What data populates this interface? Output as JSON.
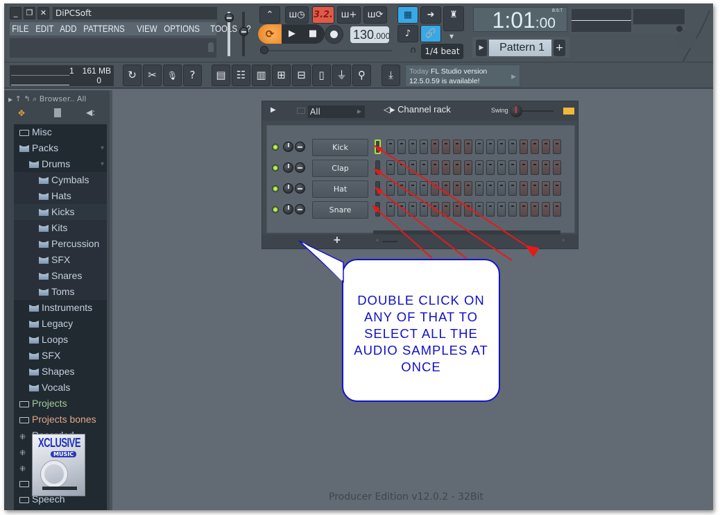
{
  "window": {
    "title": "DiPCSoft",
    "controls": {
      "minimize": "_",
      "restore": "❐",
      "close": "✕"
    }
  },
  "menu": [
    "FILE",
    "EDIT",
    "ADD",
    "PATTERNS",
    "VIEW",
    "OPTIONS",
    "TOOLS",
    "?"
  ],
  "transport": {
    "mode_display": "3.2.",
    "tempo_int": "130",
    "tempo_frac": ".000",
    "snap": "1/4 beat",
    "time_main": "1:01",
    "time_sub": ":00",
    "time_format": "B:S:T",
    "pattern": "Pattern 1",
    "pattern_add": "+",
    "loop_icon": "⟳",
    "play_icon": "▶",
    "stop_icon": "■"
  },
  "resources": {
    "cpu_value": "1",
    "memory": "161 MB",
    "polyphony": "0"
  },
  "toolbar": {
    "tools": [
      {
        "icon": "undo-icon",
        "glyph": "↻"
      },
      {
        "icon": "cut-icon",
        "glyph": "✂"
      },
      {
        "icon": "microphone-icon",
        "glyph": "🎙"
      },
      {
        "icon": "help-icon",
        "glyph": "?"
      }
    ],
    "windows": [
      {
        "icon": "playlist-icon",
        "glyph": "▤"
      },
      {
        "icon": "channel-rack-icon",
        "glyph": "☷"
      },
      {
        "icon": "piano-roll-icon",
        "glyph": "▥"
      },
      {
        "icon": "browser-icon",
        "glyph": "⊞"
      },
      {
        "icon": "mixer-icon",
        "glyph": "⊟"
      },
      {
        "icon": "project-info-icon",
        "glyph": "▯"
      },
      {
        "icon": "plugin-icon",
        "glyph": "⏚"
      },
      {
        "icon": "tempo-tapper-icon",
        "glyph": "⚲"
      }
    ],
    "download_glyph": "⤓"
  },
  "news": {
    "when": "Today",
    "line1": "FL Studio version",
    "line2": "12.5.0.59 is available!"
  },
  "browser": {
    "header": "Browser.. All",
    "items": [
      {
        "label": "Misc",
        "icon": "folder",
        "level": 0,
        "style": ""
      },
      {
        "label": "Packs",
        "icon": "pack",
        "level": 0,
        "style": ""
      },
      {
        "label": "Drums",
        "icon": "pack",
        "level": 1,
        "style": ""
      },
      {
        "label": "Cymbals",
        "icon": "pack",
        "level": 2,
        "style": ""
      },
      {
        "label": "Hats",
        "icon": "pack",
        "level": 2,
        "style": ""
      },
      {
        "label": "Kicks",
        "icon": "pack",
        "level": 2,
        "style": "selected"
      },
      {
        "label": "Kits",
        "icon": "pack",
        "level": 2,
        "style": ""
      },
      {
        "label": "Percussion",
        "icon": "pack",
        "level": 2,
        "style": ""
      },
      {
        "label": "SFX",
        "icon": "pack",
        "level": 2,
        "style": ""
      },
      {
        "label": "Snares",
        "icon": "pack",
        "level": 2,
        "style": ""
      },
      {
        "label": "Toms",
        "icon": "pack",
        "level": 2,
        "style": ""
      },
      {
        "label": "Instruments",
        "icon": "pack",
        "level": 1,
        "style": ""
      },
      {
        "label": "Legacy",
        "icon": "pack",
        "level": 1,
        "style": ""
      },
      {
        "label": "Loops",
        "icon": "pack",
        "level": 1,
        "style": ""
      },
      {
        "label": "SFX",
        "icon": "pack",
        "level": 1,
        "style": ""
      },
      {
        "label": "Shapes",
        "icon": "pack",
        "level": 1,
        "style": ""
      },
      {
        "label": "Vocals",
        "icon": "pack",
        "level": 1,
        "style": ""
      },
      {
        "label": "Projects",
        "icon": "folder",
        "level": 0,
        "style": "green"
      },
      {
        "label": "Projects bones",
        "icon": "folder",
        "level": 0,
        "style": "orange"
      },
      {
        "label": "Recorded",
        "icon": "wave",
        "level": 0,
        "style": ""
      },
      {
        "label": "",
        "icon": "wave",
        "level": 0,
        "style": ""
      },
      {
        "label": "",
        "icon": "wave",
        "level": 0,
        "style": ""
      },
      {
        "label": "",
        "icon": "folder",
        "level": 0,
        "style": ""
      },
      {
        "label": "Speech",
        "icon": "folder",
        "level": 0,
        "style": ""
      }
    ]
  },
  "thumbnail": {
    "title": "XCLUSIVE",
    "subtitle": "MUSIC"
  },
  "channel_rack": {
    "title": "Channel rack",
    "filter": "All",
    "swing_label": "Swing",
    "add_label": "+",
    "step_pattern": [
      "g",
      "g",
      "g",
      "g",
      "r",
      "r",
      "r",
      "r",
      "g",
      "g",
      "g",
      "g",
      "r",
      "r",
      "r",
      "r"
    ],
    "channels": [
      {
        "name": "Kick",
        "selected": true
      },
      {
        "name": "Clap",
        "selected": false
      },
      {
        "name": "Hat",
        "selected": false
      },
      {
        "name": "Snare",
        "selected": false
      }
    ]
  },
  "annotation": {
    "text": "DOUBLE CLICK ON ANY OF THAT TO SELECT ALL THE AUDIO SAMPLES AT ONCE",
    "lines": [
      "DOUBLE CLICK ON",
      "ANY OF THAT TO",
      "SELECT ALL THE",
      "AUDIO SAMPLES AT",
      "ONCE"
    ],
    "text_color": "#1010c8",
    "arrow_color": "#e61a1a"
  },
  "footer": {
    "edition": "Producer Edition v12.0.2 - 32Bit"
  }
}
